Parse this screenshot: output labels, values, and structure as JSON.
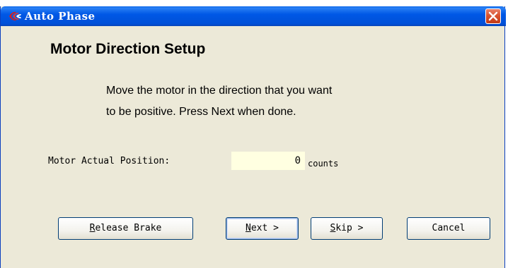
{
  "window": {
    "title": "Auto Phase"
  },
  "page": {
    "heading": "Motor Direction Setup",
    "instruction_line1": "Move the motor in the direction that you want",
    "instruction_line2": "to be positive.  Press Next when done."
  },
  "position": {
    "label": "Motor Actual Position:",
    "value": "0",
    "units": "counts"
  },
  "buttons": {
    "release_brake": {
      "mnemonic": "R",
      "rest": "elease Brake"
    },
    "next": {
      "mnemonic": "N",
      "rest": "ext >"
    },
    "skip": {
      "mnemonic": "S",
      "rest": "kip >"
    },
    "cancel": {
      "label": "Cancel"
    }
  },
  "colors": {
    "titlebar": "#0058e6",
    "window_bg": "#ece9d8",
    "position_bg": "#ffffe1",
    "close_button": "#d9532f"
  },
  "icons": {
    "app": "app-logo-icon",
    "close": "close-icon"
  }
}
